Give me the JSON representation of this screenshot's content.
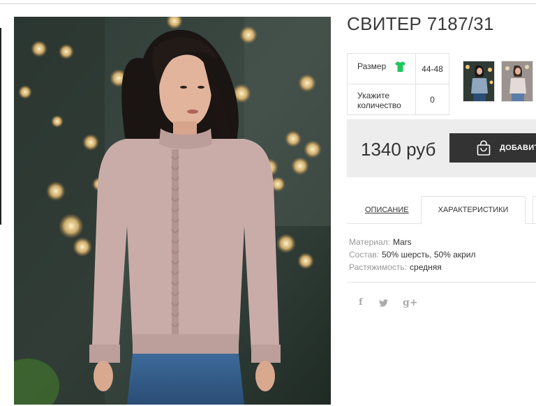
{
  "product": {
    "title": "СВИТЕР 7187/31"
  },
  "options": {
    "size_label": "Размер",
    "size_value": "44-48",
    "qty_label": "Укажите количество",
    "qty_value": "0"
  },
  "purchase": {
    "price": "1340 руб",
    "add_button_label": "ДОБАВИТ"
  },
  "tabs": [
    {
      "label": "ОПИСАНИЕ",
      "active": false
    },
    {
      "label": "ХАРАКТЕРИСТИКИ",
      "active": true
    }
  ],
  "specs": [
    {
      "key": "Материал:",
      "value": "Mars"
    },
    {
      "key": "Состав:",
      "value": "50% шерсть, 50% акрил"
    },
    {
      "key": "Растяжимость:",
      "value": "средняя"
    }
  ],
  "social": {
    "facebook": "f",
    "twitter": "t",
    "google": "g+"
  },
  "colors": {
    "accent_green": "#22c55e",
    "button_dark": "#333333",
    "price_bg": "#ededed",
    "sweater": "#c9aca8"
  },
  "icons": [
    "tshirt-icon",
    "shopping-bag-icon",
    "facebook-icon",
    "twitter-icon",
    "google-plus-icon"
  ]
}
